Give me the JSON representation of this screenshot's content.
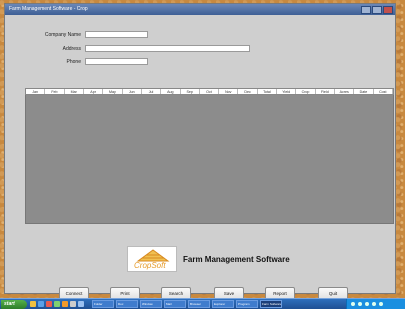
{
  "window": {
    "title": "Farm Management Software - Crop"
  },
  "form": {
    "company_label": "Company Name",
    "company_value": "",
    "address_label": "Address",
    "address_value": "",
    "phone_label": "Phone",
    "phone_value": ""
  },
  "grid": {
    "columns": [
      "Jan",
      "Feb",
      "Mar",
      "Apr",
      "May",
      "Jun",
      "Jul",
      "Aug",
      "Sep",
      "Oct",
      "Nov",
      "Dec",
      "Total",
      "Yield",
      "Crop",
      "Field",
      "Acres",
      "Date",
      "Cost"
    ]
  },
  "branding": {
    "logo_text": "CropSoft",
    "tagline": "Farm Management Software"
  },
  "buttons": {
    "connect": "Connect",
    "print": "Print",
    "search": "Search",
    "save": "Save",
    "report": "Report",
    "quit": "Quit"
  },
  "taskbar": {
    "start_label": "start",
    "tasks": [
      "Folder",
      "Doc",
      "Window",
      "Mail",
      "Browser",
      "Explorer",
      "Program",
      "Farm Software"
    ]
  }
}
